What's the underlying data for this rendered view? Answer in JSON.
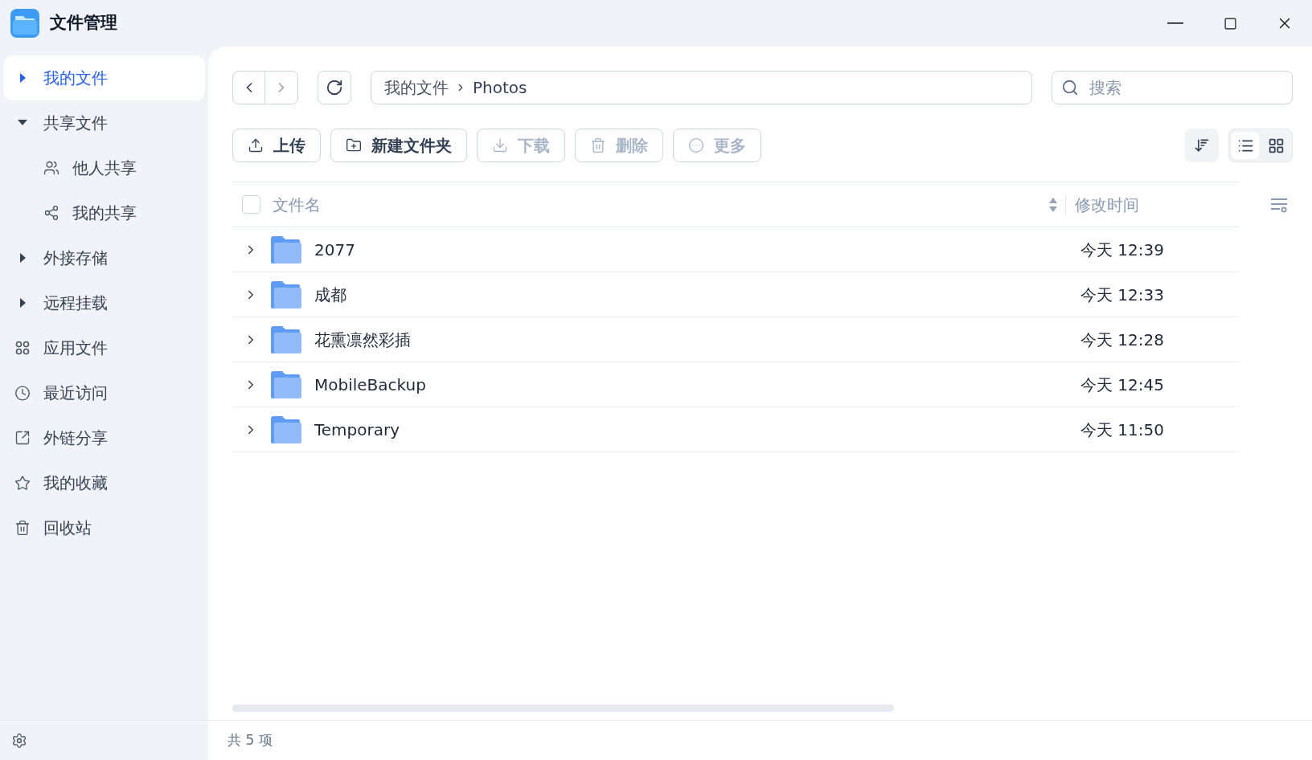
{
  "window": {
    "title": "文件管理"
  },
  "sidebar": {
    "items": [
      {
        "kind": "expander",
        "label": "我的文件",
        "selected": true,
        "expanded": false
      },
      {
        "kind": "expander",
        "label": "共享文件",
        "selected": false,
        "expanded": true,
        "children": [
          {
            "kind": "child",
            "label": "他人共享",
            "selected": false
          },
          {
            "kind": "child",
            "label": "我的共享",
            "selected": false
          }
        ]
      },
      {
        "kind": "expander",
        "label": "外接存储",
        "selected": false,
        "expanded": false
      },
      {
        "kind": "expander",
        "label": "远程挂载",
        "selected": false,
        "expanded": false
      },
      {
        "kind": "icon",
        "label": "应用文件",
        "selected": false
      },
      {
        "kind": "icon",
        "label": "最近访问",
        "selected": false
      },
      {
        "kind": "icon",
        "label": "外链分享",
        "selected": false
      },
      {
        "kind": "icon",
        "label": "我的收藏",
        "selected": false
      },
      {
        "kind": "icon",
        "label": "回收站",
        "selected": false
      }
    ]
  },
  "nav": {
    "back_disabled": false,
    "forward_disabled": true
  },
  "breadcrumb": [
    "我的文件",
    "Photos"
  ],
  "search": {
    "placeholder": "搜索"
  },
  "toolbar": [
    {
      "label": "上传",
      "disabled": false
    },
    {
      "label": "新建文件夹",
      "disabled": false
    },
    {
      "label": "下载",
      "disabled": true
    },
    {
      "label": "删除",
      "disabled": true
    },
    {
      "label": "更多",
      "disabled": true
    }
  ],
  "view_toggle": [
    {
      "kind": "list",
      "selected": true
    },
    {
      "kind": "grid",
      "selected": false
    }
  ],
  "table": {
    "columns": [
      "文件名",
      "修改时间"
    ],
    "select_all_checked": false,
    "rows": [
      {
        "name": "2077",
        "modified": "今天 12:39",
        "checked": false
      },
      {
        "name": "成都",
        "modified": "今天 12:33",
        "checked": false
      },
      {
        "name": "花熏凛然彩插",
        "modified": "今天 12:28",
        "checked": false
      },
      {
        "name": "MobileBackup",
        "modified": "今天 12:45",
        "checked": false
      },
      {
        "name": "Temporary",
        "modified": "今天 11:50",
        "checked": false
      }
    ]
  },
  "status_bar": "共 5 项"
}
